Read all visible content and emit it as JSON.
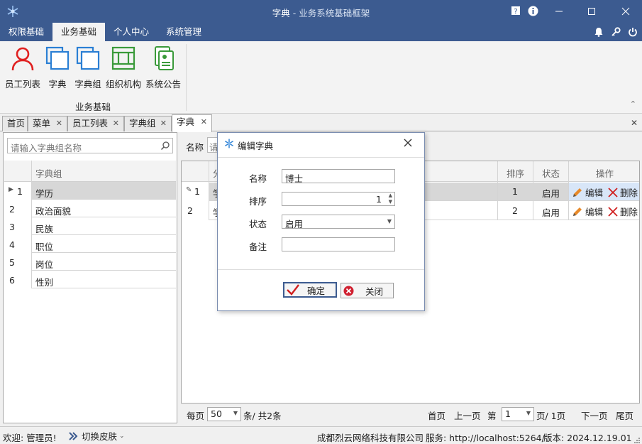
{
  "window": {
    "title": "字典",
    "subtitle": " - 业务系统基础框架"
  },
  "menus": [
    {
      "label": "权限基础"
    },
    {
      "label": "业务基础"
    },
    {
      "label": "个人中心"
    },
    {
      "label": "系统管理"
    }
  ],
  "ribbon": {
    "buttons": [
      {
        "label": "员工列表",
        "icon": "user-icon"
      },
      {
        "label": "字典",
        "icon": "dictionary-icon"
      },
      {
        "label": "字典组",
        "icon": "dictionary-group-icon"
      },
      {
        "label": "组织机构",
        "icon": "organization-icon"
      },
      {
        "label": "系统公告",
        "icon": "notice-icon"
      }
    ],
    "group_label": "业务基础"
  },
  "tabs": [
    {
      "label": "首页",
      "closable": false
    },
    {
      "label": "菜单",
      "closable": true
    },
    {
      "label": "员工列表",
      "closable": true
    },
    {
      "label": "字典组",
      "closable": true
    },
    {
      "label": "字典",
      "closable": true
    }
  ],
  "left_panel": {
    "search_placeholder": "请输入字典组名称",
    "column_header": "字典组",
    "rows": [
      {
        "index": "1",
        "name": "学历"
      },
      {
        "index": "2",
        "name": "政治面貌"
      },
      {
        "index": "3",
        "name": "民族"
      },
      {
        "index": "4",
        "name": "职位"
      },
      {
        "index": "5",
        "name": "岗位"
      },
      {
        "index": "6",
        "name": "性别"
      }
    ]
  },
  "right_panel": {
    "filter_label": "名称",
    "filter_placeholder": "请",
    "columns": {
      "group": "分",
      "sort": "排序",
      "status": "状态",
      "action": "操作"
    },
    "rows": [
      {
        "index": "1",
        "group": "学",
        "sort": "1",
        "status": "启用"
      },
      {
        "index": "2",
        "group": "学",
        "sort": "2",
        "status": "启用"
      }
    ],
    "edit_label": "编辑",
    "delete_label": "删除"
  },
  "pager": {
    "per_page_label": "每页",
    "page_size": "50",
    "total_text": "条/ 共2条",
    "first": "首页",
    "prev": "上一页",
    "page_label": "第",
    "page": "1",
    "of_pages": "页/ 1页",
    "next": "下一页",
    "last": "尾页"
  },
  "dialog": {
    "title": "编辑字典",
    "fields": {
      "name_label": "名称",
      "name_value": "博士",
      "sort_label": "排序",
      "sort_value": "1",
      "status_label": "状态",
      "status_value": "启用",
      "remark_label": "备注",
      "remark_value": ""
    },
    "ok_label": "确定",
    "close_label": "关闭"
  },
  "status": {
    "welcome": "欢迎: 管理员!",
    "skin": "切换皮肤",
    "company": "成都烈云网络科技有限公司",
    "server": "服务: http://localhost:5264/",
    "version": "版本: 2024.12.19.01"
  },
  "colors": {
    "titlebar": "#3c5b90",
    "accent_red": "#e02020",
    "accent_blue": "#2a7fd4",
    "accent_green": "#3a9a3a"
  }
}
